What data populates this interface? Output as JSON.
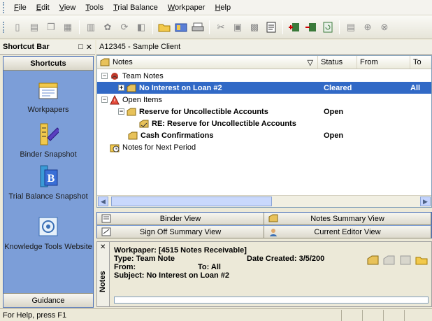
{
  "menu": [
    "File",
    "Edit",
    "View",
    "Tools",
    "Trial Balance",
    "Workpaper",
    "Help"
  ],
  "shortcut_bar": {
    "title": "Shortcut Bar",
    "tab_label": "Shortcuts",
    "items": [
      {
        "label": "Workpapers",
        "icon": "workpapers-icon"
      },
      {
        "label": "Binder Snapshot",
        "icon": "binder-snapshot-icon"
      },
      {
        "label": "Trial Balance Snapshot",
        "icon": "trial-balance-snapshot-icon"
      },
      {
        "label": "Knowledge Tools Website",
        "icon": "knowledge-tools-icon"
      }
    ],
    "bottom_tab": "Guidance"
  },
  "client": {
    "name": "A12345 - Sample Client"
  },
  "notes": {
    "columns": [
      "Notes",
      "Status",
      "From",
      "To"
    ],
    "rows": [
      {
        "label": "Team Notes",
        "status": "",
        "to": ""
      },
      {
        "label": "No Interest on Loan #2",
        "status": "Cleared",
        "to": "All"
      },
      {
        "label": "Open Items",
        "status": "",
        "to": ""
      },
      {
        "label": "Reserve for Uncollectible Accounts",
        "status": "Open",
        "to": ""
      },
      {
        "label": "RE: Reserve for Uncollectible Accounts",
        "status": "",
        "to": ""
      },
      {
        "label": "Cash Confirmations",
        "status": "Open",
        "to": ""
      },
      {
        "label": "Notes for Next Period",
        "status": "",
        "to": ""
      }
    ]
  },
  "views": {
    "binder": "Binder View",
    "notes_summary": "Notes Summary View",
    "sign_off": "Sign Off Summary View",
    "current_editor": "Current Editor View"
  },
  "details": {
    "side_tab": "Notes",
    "workpaper": "Workpaper: [4515 Notes Receivable]",
    "type": "Type: Team Note",
    "date_created": "Date Created: 3/5/200",
    "from": "From:",
    "to": "To: All",
    "subject": "Subject: No Interest on Loan #2"
  },
  "status_bar": {
    "text": "For Help, press F1"
  },
  "colors": {
    "selection": "#3169c6",
    "panel_blue": "#7c9ed8"
  }
}
